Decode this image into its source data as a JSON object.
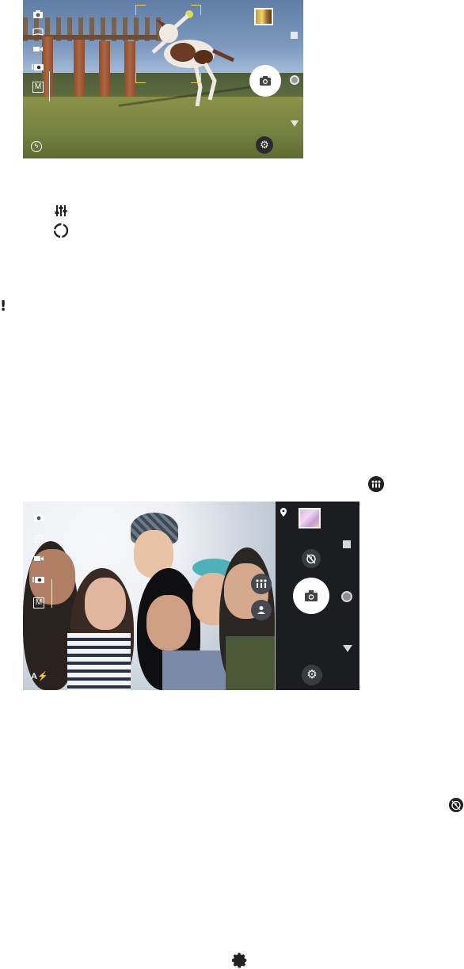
{
  "viewfinder_outdoor": {
    "mode_icons": [
      "camera-switch-icon",
      "panorama-icon",
      "video-icon",
      "superior-auto-icon",
      "manual-icon"
    ],
    "manual_label": "M",
    "icon_names": {
      "thumbnail": "photo-thumbnail",
      "shutter": "camera-icon",
      "record": "record-dot-icon",
      "video": "video-square-icon",
      "more": "triangle-down-icon",
      "settings": "gear-icon",
      "flash": "flash-off-icon"
    }
  },
  "inline_icons": {
    "sliders": "sliders-icon",
    "ring": "ring-icon",
    "note": "!",
    "group": "group-selfie-icon",
    "timer": "self-timer-icon",
    "gear": "gear-icon"
  },
  "viewfinder_selfie": {
    "mode_icons": [
      "camera-switch-icon",
      "effects-icon",
      "video-icon",
      "superior-auto-icon",
      "manual-icon"
    ],
    "manual_label": "M",
    "flash_label": "A⚡",
    "icon_names": {
      "location": "pin-icon",
      "thumbnail": "photo-thumbnail",
      "timer": "self-timer-icon",
      "shutter": "camera-icon",
      "record": "record-dot-icon",
      "video": "video-square-icon",
      "more": "triangle-down-icon",
      "settings": "gear-icon",
      "group": "group-selfie-icon",
      "single": "person-icon"
    }
  }
}
